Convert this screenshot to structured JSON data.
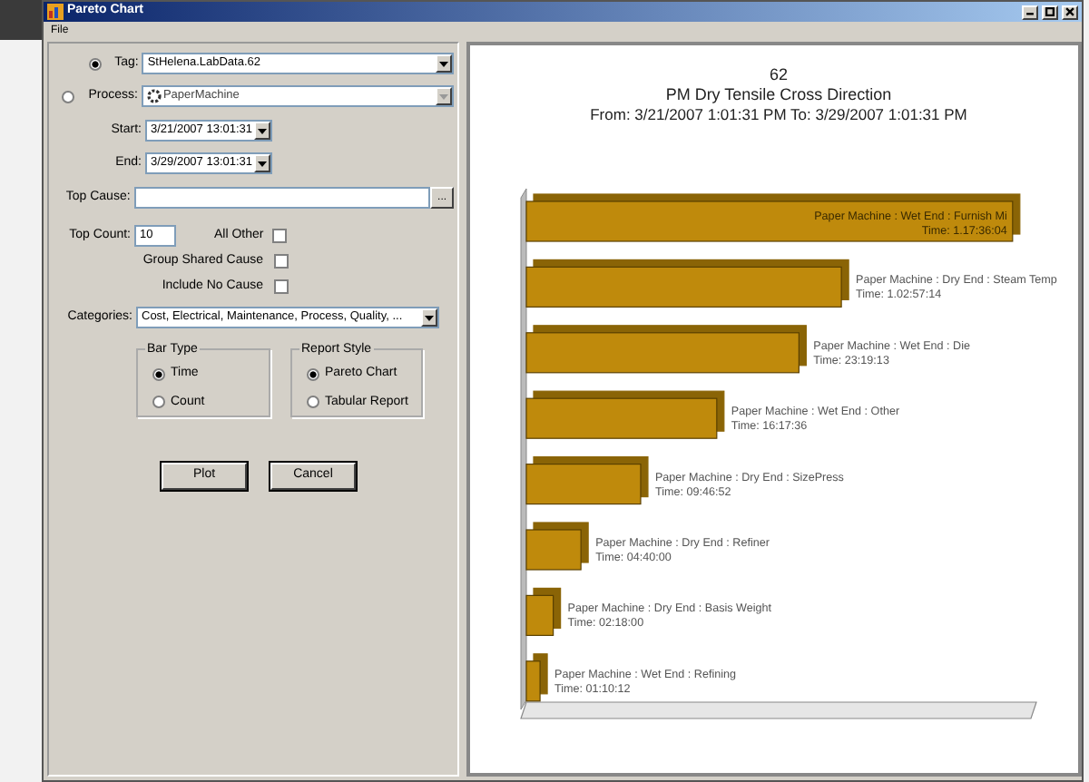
{
  "window": {
    "title": "Pareto Chart",
    "menu": [
      "File"
    ]
  },
  "form": {
    "sources": [
      {
        "kind": "tag",
        "label": "Tag:",
        "selected": true,
        "value": "StHelena.LabData.62",
        "disabled": false
      },
      {
        "kind": "process",
        "label": "Process:",
        "selected": false,
        "value": "PaperMachine",
        "disabled": true
      }
    ],
    "start": {
      "label": "Start:",
      "value": "3/21/2007 13:01:31"
    },
    "end": {
      "label": "End:",
      "value": "3/29/2007 13:01:31"
    },
    "top_cause": {
      "label": "Top Cause:",
      "browse": "..."
    },
    "top_count": {
      "label": "Top Count:",
      "value": "10"
    },
    "checkboxes": [
      {
        "label": "All Other",
        "checked": false
      },
      {
        "label": "Group Shared Cause",
        "checked": false
      },
      {
        "label": "Include No Cause",
        "checked": false
      }
    ],
    "categories": {
      "label": "Categories:",
      "value": "Cost, Electrical, Maintenance, Process, Quality, ..."
    },
    "bar_type": {
      "title": "Bar Type",
      "options": [
        {
          "label": "Time",
          "selected": true
        },
        {
          "label": "Count",
          "selected": false
        }
      ]
    },
    "report_style": {
      "title": "Report Style",
      "options": [
        {
          "label": "Pareto Chart",
          "selected": true
        },
        {
          "label": "Tabular Report",
          "selected": false
        }
      ]
    },
    "buttons": [
      "Plot",
      "Cancel"
    ]
  },
  "chart": {
    "title_lines": [
      "62",
      "PM Dry Tensile Cross Direction",
      "From: 3/21/2007 1:01:31 PM  To: 3/29/2007 1:01:31 PM"
    ],
    "chart_data": {
      "type": "bar",
      "orientation": "horizontal",
      "categories": [
        "Paper Machine : Wet End : Furnish Mi",
        "Paper Machine : Dry End : Steam Temp",
        "Paper Machine : Wet End : Die",
        "Paper Machine : Wet End : Other",
        "Paper Machine : Dry End : SizePress",
        "Paper Machine : Dry End : Refiner",
        "Paper Machine : Dry End : Basis Weight",
        "Paper Machine : Wet End : Refining"
      ],
      "values": [
        41.6,
        26.95,
        23.32,
        16.29,
        9.78,
        4.67,
        2.3,
        1.17
      ],
      "value_labels": [
        "Time: 1.17:36:04",
        "Time: 1.02:57:14",
        "Time: 23:19:13",
        "Time: 16:17:36",
        "Time: 09:46:52",
        "Time: 04:40:00",
        "Time: 02:18:00",
        "Time: 01:10:12"
      ]
    }
  }
}
